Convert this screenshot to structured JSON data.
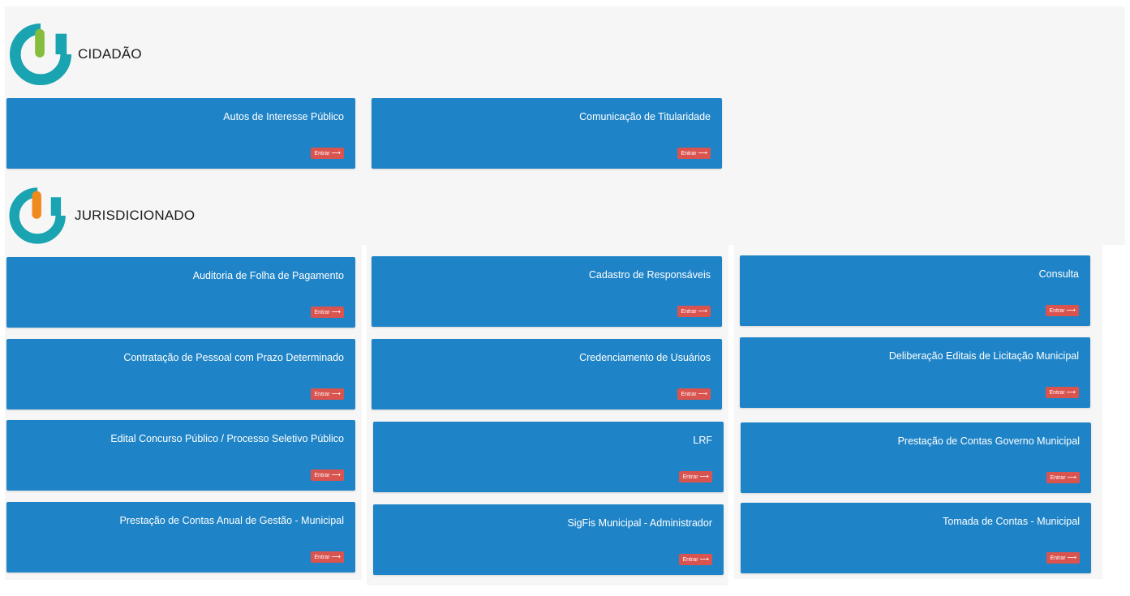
{
  "colors": {
    "card": "#1f84c7",
    "enter_button": "#d9534f",
    "logo_ring": "#1aa3b1",
    "cidadao_accent": "#86bd3c",
    "jurisdicionado_accent": "#f08a1c"
  },
  "cidadao": {
    "title": "CIDADÃO",
    "logo_icon": "cidadao-logo-icon",
    "cards": [
      {
        "title": "Autos de Interesse Público",
        "button": "Entrar"
      },
      {
        "title": "Comunicação de Titularidade",
        "button": "Entrar"
      }
    ]
  },
  "jurisdicionado": {
    "title": "JURISDICIONADO",
    "logo_icon": "jurisdicionado-logo-icon",
    "cards": [
      {
        "title": "Auditoria de Folha de Pagamento",
        "button": "Entrar"
      },
      {
        "title": "Cadastro de Responsáveis",
        "button": "Entrar"
      },
      {
        "title": "Consulta",
        "button": "Entrar"
      },
      {
        "title": "Contratação de Pessoal com Prazo Determinado",
        "button": "Entrar"
      },
      {
        "title": "Credenciamento de Usuários",
        "button": "Entrar"
      },
      {
        "title": "Deliberação Editais de Licitação Municipal",
        "button": "Entrar"
      },
      {
        "title": "Edital Concurso Público / Processo Seletivo Público",
        "button": "Entrar"
      },
      {
        "title": "LRF",
        "button": "Entrar"
      },
      {
        "title": "Prestação de Contas Governo Municipal",
        "button": "Entrar"
      },
      {
        "title": "Prestação de Contas Anual de Gestão - Municipal",
        "button": "Entrar"
      },
      {
        "title": "SigFis Municipal - Administrador",
        "button": "Entrar"
      },
      {
        "title": "Tomada de Contas - Municipal",
        "button": "Entrar"
      }
    ]
  },
  "icons": {
    "enter_arrow": "arrow-right-icon"
  }
}
